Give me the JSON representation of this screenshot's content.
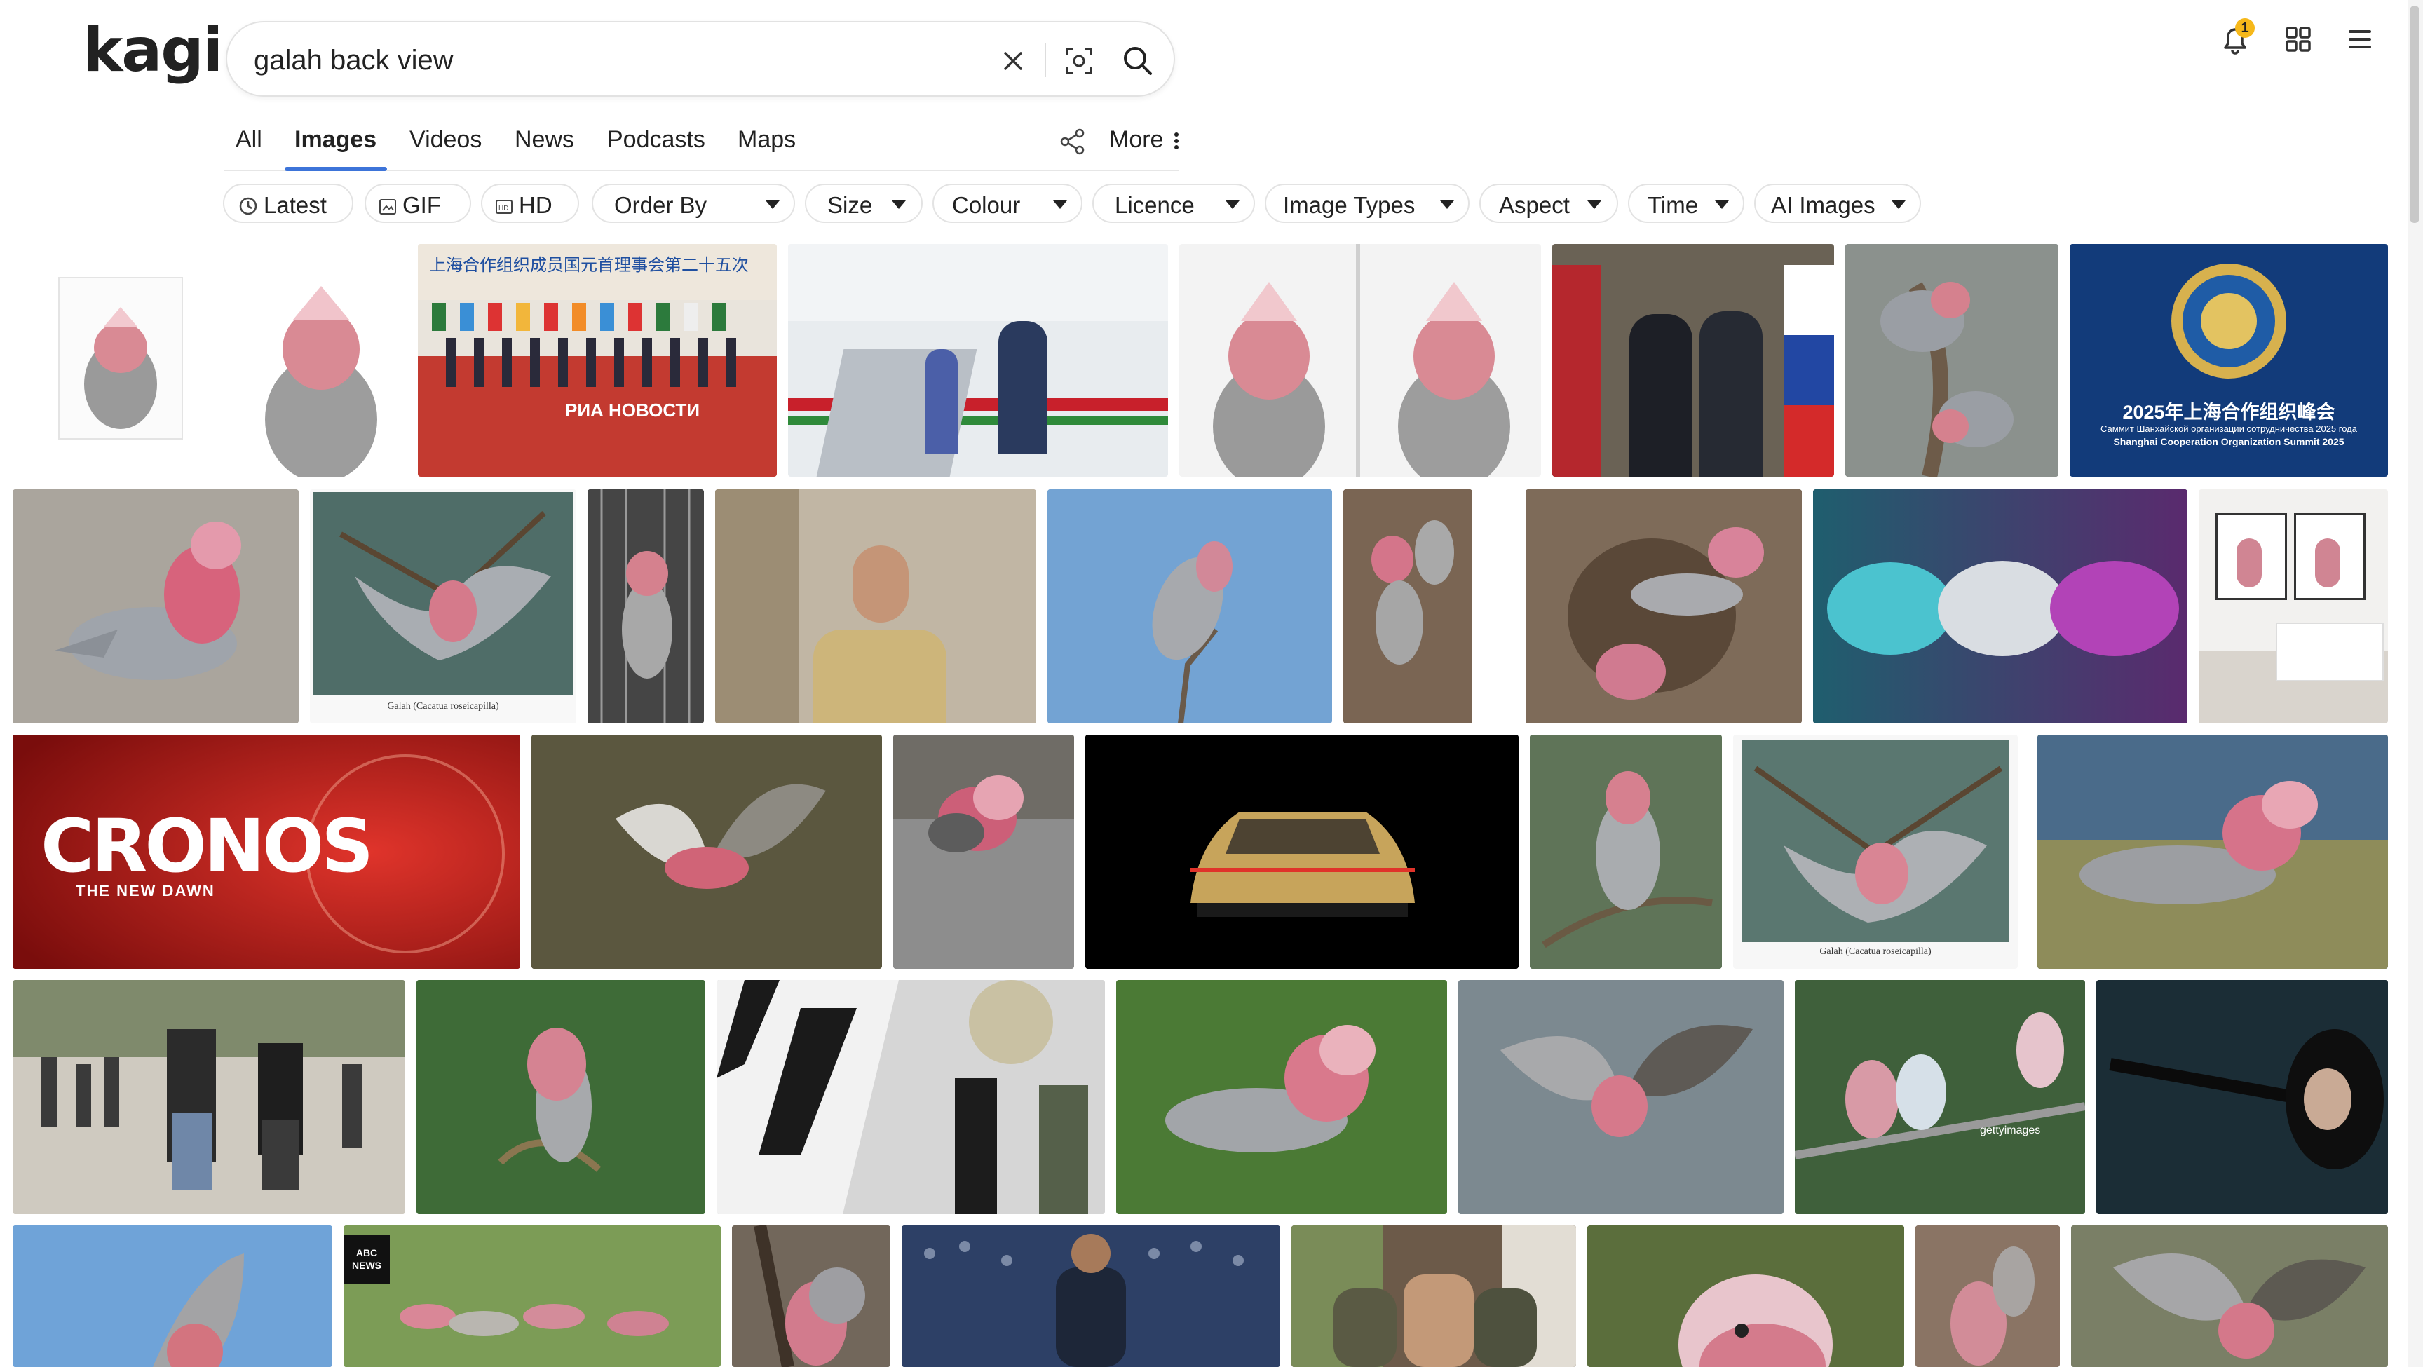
{
  "logo": {
    "text": "kagi"
  },
  "search": {
    "query": "galah back view",
    "clear_label": "clear-search",
    "image_search_label": "search-by-image",
    "submit_label": "search"
  },
  "tabs": [
    {
      "label": "All",
      "active": false
    },
    {
      "label": "Images",
      "active": true
    },
    {
      "label": "Videos",
      "active": false
    },
    {
      "label": "News",
      "active": false
    },
    {
      "label": "Podcasts",
      "active": false
    },
    {
      "label": "Maps",
      "active": false
    }
  ],
  "more_label": "More",
  "filters": [
    {
      "label": "Latest",
      "icon": "clock-icon"
    },
    {
      "label": "GIF",
      "icon": "gif-icon"
    },
    {
      "label": "HD",
      "icon": "hd-icon"
    },
    {
      "label": "Order By",
      "dropdown": true
    },
    {
      "label": "Size",
      "dropdown": true
    },
    {
      "label": "Colour",
      "dropdown": true
    },
    {
      "label": "Licence",
      "dropdown": true
    },
    {
      "label": "Image Types",
      "dropdown": true
    },
    {
      "label": "Aspect",
      "dropdown": true
    },
    {
      "label": "Time",
      "dropdown": true
    },
    {
      "label": "AI Images",
      "dropdown": true
    }
  ],
  "notifications": {
    "count": "1"
  },
  "thumbnail_texts": {
    "cronos_title": "CRONOS",
    "cronos_subtitle": "THE NEW DAWN",
    "ria": "РИА НОВОСТИ",
    "sco_banner_cn": "2025年上海合作组织峰会",
    "sco_banner_en": "Shanghai Cooperation Organization Summit 2025",
    "sco_banner_ru": "Саммит Шанхайской организации сотрудничества 2025 года",
    "sco_meeting_cn": "上海合作组织成员国元首理事会第二十五次",
    "galah_caption": "Galah (Cacatua roseicapilla)",
    "getty": "gettyimages",
    "abc": "ABC NEWS"
  },
  "colors": {
    "accent": "#3d74d9",
    "badge": "#f6b81a"
  }
}
